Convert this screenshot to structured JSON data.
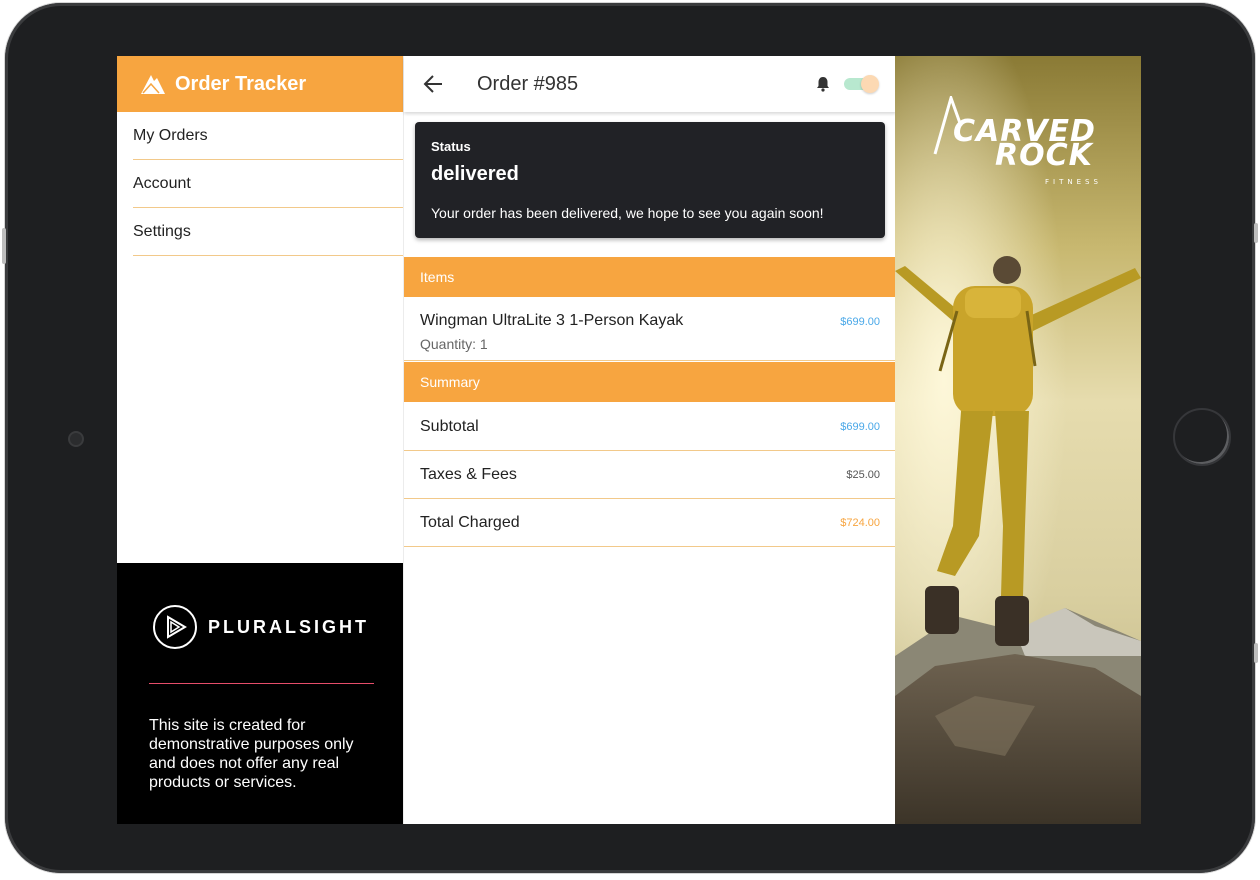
{
  "nav": {
    "title": "Order Tracker",
    "items": [
      {
        "label": "My Orders"
      },
      {
        "label": "Account"
      },
      {
        "label": "Settings"
      }
    ],
    "footer": {
      "brand": "PLURALSIGHT",
      "disclaimer": "This site is created for demonstrative purposes only and does not offer any real products or services."
    }
  },
  "order": {
    "title": "Order #985",
    "status": {
      "label": "Status",
      "value": "delivered",
      "message": "Your order has been delivered, we hope to see you again soon!"
    },
    "items_header": "Items",
    "items": [
      {
        "name": "Wingman UltraLite 3 1-Person Kayak",
        "quantity": "Quantity: 1",
        "price": "$699.00"
      }
    ],
    "summary_header": "Summary",
    "summary": {
      "subtotal_label": "Subtotal",
      "subtotal": "$699.00",
      "taxes_label": "Taxes & Fees",
      "taxes": "$25.00",
      "total_label": "Total Charged",
      "total": "$724.00"
    }
  },
  "notifications_toggle": {
    "on": true
  },
  "colors": {
    "accent": "#f7a540",
    "subtotal": "#4aa8e8",
    "taxes": "#555555",
    "total": "#f7a540",
    "status_card": "#212226"
  },
  "promo": {
    "brand_line1": "CARVED",
    "brand_line2": "ROCK",
    "brand_sub": "FITNESS"
  }
}
